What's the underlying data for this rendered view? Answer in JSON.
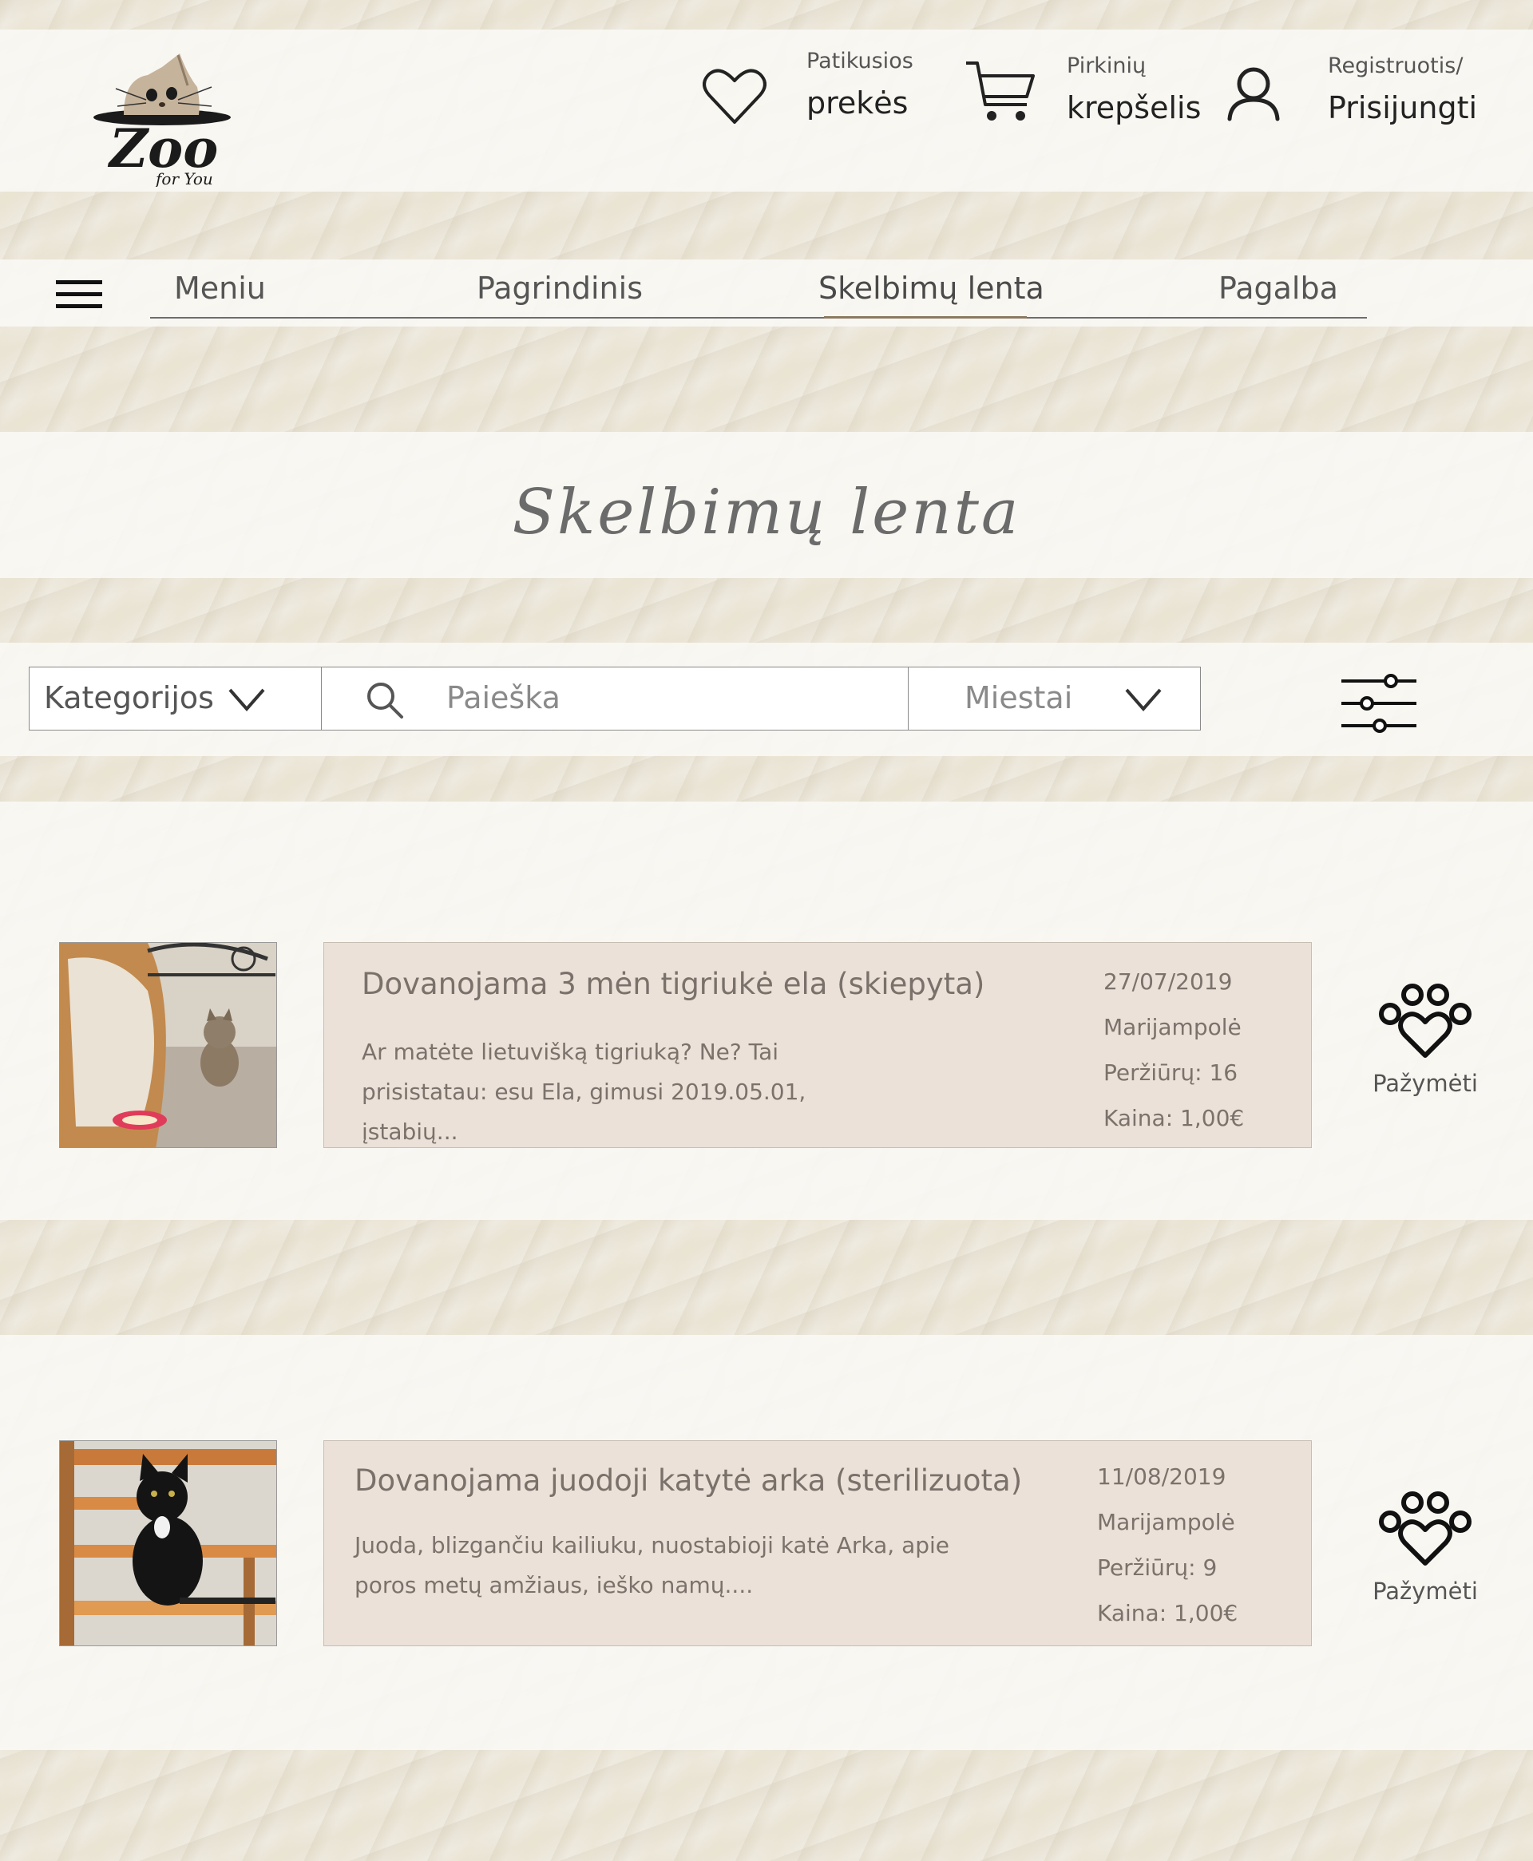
{
  "header": {
    "logo": {
      "text": "Zoo",
      "subtext": "for You"
    },
    "favorites": {
      "small": "Patikusios",
      "big": "prekės",
      "icon": "heart-icon"
    },
    "cart": {
      "small": "Pirkinių",
      "big": "krepšelis",
      "icon": "cart-icon"
    },
    "account": {
      "small": "Registruotis/",
      "big": "Prisijungti",
      "icon": "user-icon"
    }
  },
  "nav": {
    "items": [
      "Meniu",
      "Pagrindinis",
      "Skelbimų lenta",
      "Pagalba"
    ],
    "active": "Skelbimų lenta"
  },
  "page": {
    "title": "Skelbimų lenta"
  },
  "filters": {
    "category": {
      "value": "Kategorijos"
    },
    "search": {
      "placeholder": "Paieška"
    },
    "city": {
      "value": "Miestai"
    }
  },
  "listings": [
    {
      "title": "Dovanojama 3 mėn tigriukė ela (skiepyta)",
      "description": "Ar matėte lietuvišką tigriuką? Ne? Tai prisistatau: esu Ela, gimusi 2019.05.01, įstabių...",
      "date": "27/07/2019",
      "city": "Marijampolė",
      "views": "Peržiūrų: 16",
      "price": "Kaina: 1,00€",
      "mark_label": "Pažymėti"
    },
    {
      "title": "Dovanojama juodoji katytė arka (sterilizuota)",
      "description": "Juoda, blizgančiu kailiuku, nuostabioji katė Arka, apie poros metų amžiaus, ieško namų....",
      "date": "11/08/2019",
      "city": "Marijampolė",
      "views": "Peržiūrų: 9",
      "price": "Kaina: 1,00€",
      "mark_label": "Pažymėti"
    }
  ],
  "colors": {
    "card_bg": "#ebe1d8",
    "accent_underline": "#8b7a60",
    "text_muted": "#7a716b"
  }
}
